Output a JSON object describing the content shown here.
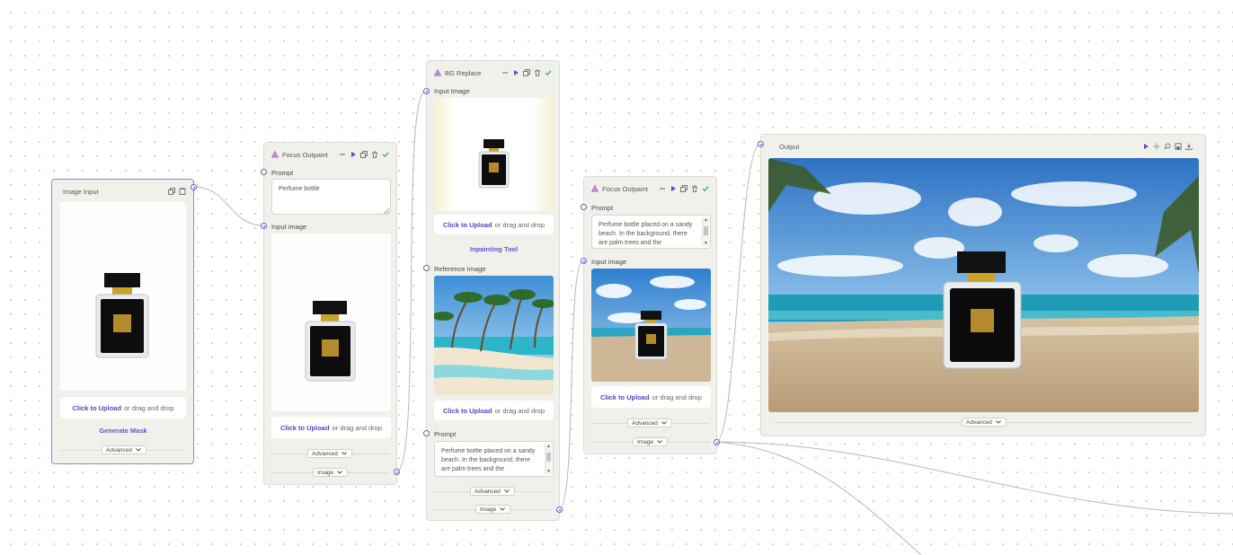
{
  "colors": {
    "accent": "#7c4ddb",
    "link": "#5b3fc4",
    "node_bg": "#f1f1ec",
    "selected_border": "#9a82e0",
    "run": "#6a40d8",
    "done": "#2fa34a"
  },
  "common": {
    "click_to_upload": "Click to Upload",
    "or_drag": "or drag and drop",
    "advanced": "Advanced",
    "image": "Image"
  },
  "image_input": {
    "title": "Image Input",
    "generate_mask": "Generate Mask"
  },
  "focus1": {
    "title": "Focus Outpaint",
    "prompt_label": "Prompt",
    "prompt_value": "Perfume bottle",
    "input_label": "Input image"
  },
  "bg": {
    "title": "BG Replace",
    "input_label": "Input Image",
    "inpainting": "Inpainting Tool",
    "reference_label": "Reference Image",
    "prompt_label": "Prompt",
    "prompt_value": "Perfume bottle placed on a sandy beach. In the background, there are palm trees and the"
  },
  "focus2": {
    "title": "Focus Outpaint",
    "prompt_label": "Prompt",
    "prompt_value": "Perfume bottle placed on a sandy beach. In the background, there are palm trees and the",
    "input_label": "Input image"
  },
  "output": {
    "title": "Output"
  },
  "icons": [
    "node-logo-icon",
    "minimize-icon",
    "run-icon",
    "duplicate-icon",
    "delete-icon",
    "check-icon",
    "chevron-down-icon",
    "move-icon",
    "zoom-icon",
    "save-icon",
    "download-icon"
  ]
}
